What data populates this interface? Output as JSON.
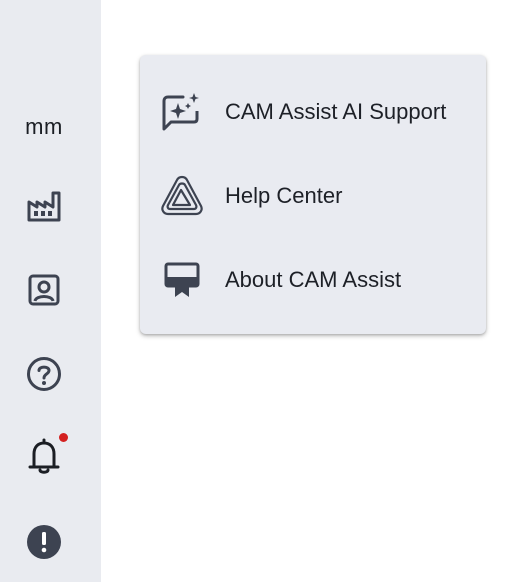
{
  "sidebar": {
    "unit_label": "mm",
    "icons": [
      {
        "name": "factory-icon"
      },
      {
        "name": "account-box-icon"
      },
      {
        "name": "help-circle-icon"
      },
      {
        "name": "bell-icon",
        "has_notification": true
      },
      {
        "name": "alert-circle-icon"
      }
    ]
  },
  "help_menu": {
    "items": [
      {
        "label": "CAM Assist AI Support",
        "icon": "ai-chat-sparkle-icon"
      },
      {
        "label": "Help Center",
        "icon": "triangle-logo-icon"
      },
      {
        "label": "About CAM Assist",
        "icon": "certificate-icon"
      }
    ]
  },
  "colors": {
    "sidebar_bg": "#e9ebf0",
    "menu_bg": "#e9ebf1",
    "icon": "#3d4351",
    "notification_dot": "#d42020"
  }
}
